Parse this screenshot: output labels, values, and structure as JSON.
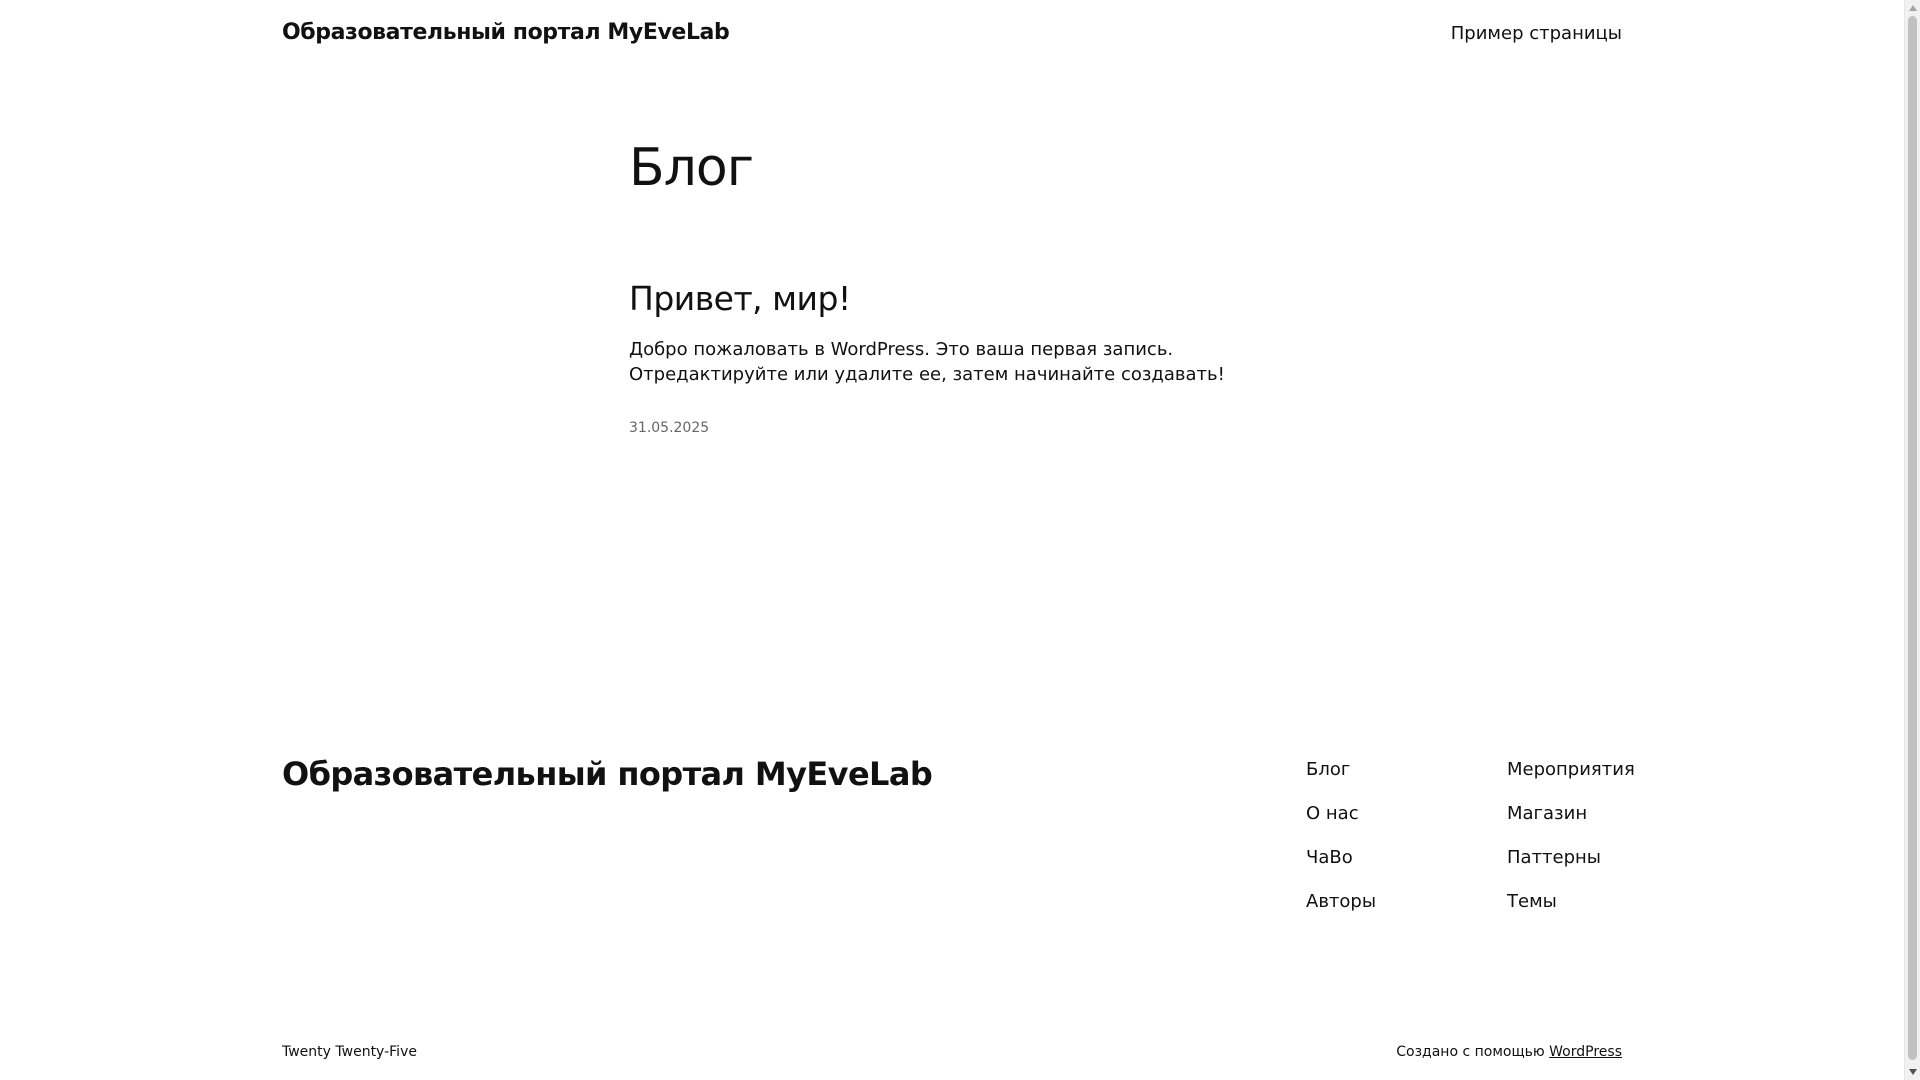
{
  "header": {
    "site_title": "Образовательный портал MyEveLab",
    "nav_item": "Пример страницы"
  },
  "main": {
    "heading": "Блог",
    "post": {
      "title": "Привет, мир!",
      "excerpt": "Добро пожаловать в WordPress. Это ваша первая запись. Отредактируйте или удалите ее, затем начинайте создавать!",
      "date": "31.05.2025"
    }
  },
  "footer": {
    "site_title": "Образовательный портал MyEveLab",
    "nav_col1": [
      "Блог",
      "О нас",
      "ЧаВо",
      "Авторы"
    ],
    "nav_col2": [
      "Мероприятия",
      "Магазин",
      "Паттерны",
      "Темы"
    ],
    "credit_left": "Twenty Twenty-Five",
    "credit_right_prefix": "Создано с помощью",
    "credit_right_link": "WordPress"
  },
  "colors": {
    "text": "#111111",
    "muted": "#666666",
    "background": "#ffffff"
  }
}
